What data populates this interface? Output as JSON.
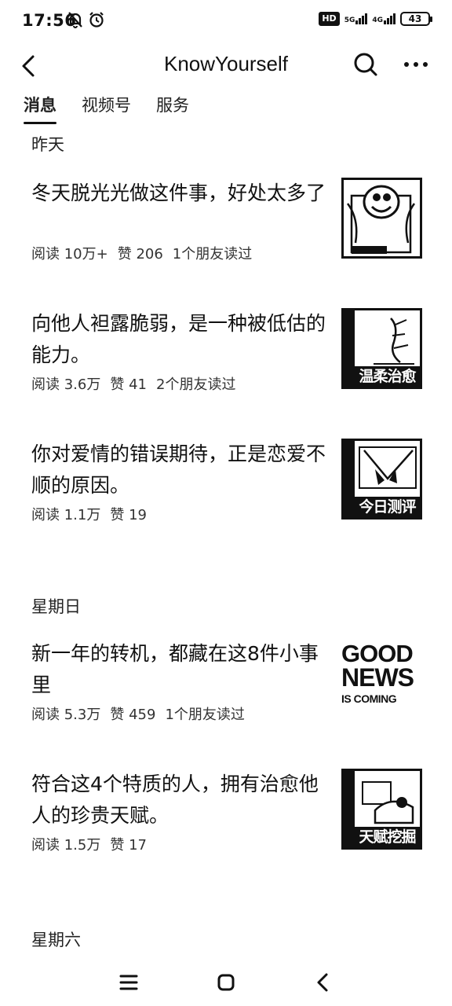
{
  "status_bar": {
    "time": "17:56",
    "hd": "HD",
    "net1": "5G",
    "net2": "4G",
    "battery": "43"
  },
  "header": {
    "title": "KnowYourself"
  },
  "tabs": [
    {
      "label": "消息",
      "active": true
    },
    {
      "label": "视频号",
      "active": false
    },
    {
      "label": "服务",
      "active": false
    }
  ],
  "sections": [
    {
      "date": "昨天",
      "articles": [
        {
          "title": "冬天脱光光做这件事，好处太多了",
          "reads": "阅读 10万+",
          "likes": "赞 206",
          "friends": "1个朋友读过",
          "thumb_caption": ""
        },
        {
          "title": "向他人袒露脆弱，是一种被低估的能力。",
          "reads": "阅读 3.6万",
          "likes": "赞 41",
          "friends": "2个朋友读过",
          "thumb_caption": "温柔治愈"
        },
        {
          "title": "你对爱情的错误期待，正是恋爱不顺的原因。",
          "reads": "阅读 1.1万",
          "likes": "赞 19",
          "friends": "",
          "thumb_caption": "今日测评"
        }
      ]
    },
    {
      "date": "星期日",
      "articles": [
        {
          "title": "新一年的转机，都藏在这8件小事里",
          "reads": "阅读 5.3万",
          "likes": "赞 459",
          "friends": "1个朋友读过",
          "thumb_caption": "",
          "thumb_text": [
            "GOOD",
            "NEWS",
            "IS COMING"
          ]
        },
        {
          "title": "符合这4个特质的人，拥有治愈他人的珍贵天赋。",
          "reads": "阅读 1.5万",
          "likes": "赞 17",
          "friends": "",
          "thumb_caption": "天赋挖掘"
        }
      ]
    },
    {
      "date": "星期六",
      "articles": []
    }
  ],
  "icons": {
    "back": "back-arrow-icon",
    "search": "search-icon",
    "more": "more-icon",
    "nav_menu": "menu-icon",
    "nav_home": "home-icon",
    "nav_back": "back-icon"
  }
}
